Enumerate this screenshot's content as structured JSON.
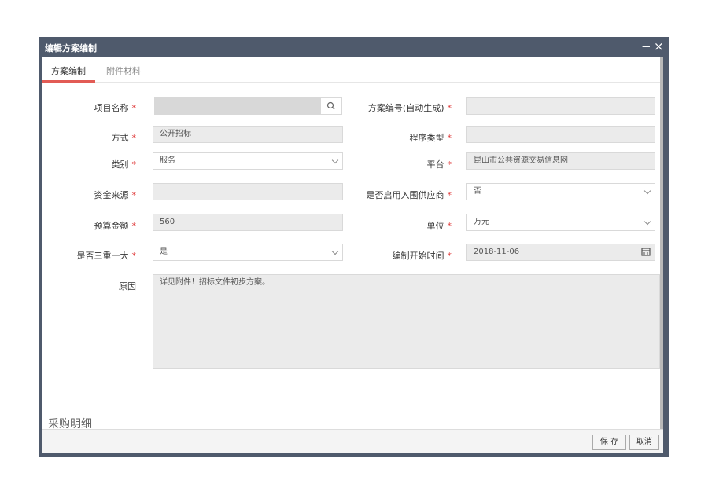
{
  "dialog": {
    "title": "编辑方案编制",
    "minimize": "−",
    "close": "×"
  },
  "tabs": [
    {
      "label": "方案编制"
    },
    {
      "label": "附件材料"
    }
  ],
  "form": {
    "required_mark": "*",
    "project_name": {
      "label": "项目名称",
      "value": ""
    },
    "plan_number": {
      "label": "方案编号(自动生成)",
      "value": ""
    },
    "method": {
      "label": "方式",
      "value": "公开招标"
    },
    "procedure_type": {
      "label": "程序类型",
      "value": ""
    },
    "category": {
      "label": "类别",
      "value": "服务"
    },
    "platform": {
      "label": "平台",
      "value": "昆山市公共资源交易信息网"
    },
    "fund_source": {
      "label": "资金来源",
      "value": ""
    },
    "enable_supplier": {
      "label": "是否启用入围供应商",
      "value": "否"
    },
    "budget": {
      "label": "预算金额",
      "value": "560"
    },
    "unit": {
      "label": "单位",
      "value": "万元"
    },
    "three_one": {
      "label": "是否三重一大",
      "value": "是"
    },
    "start_time": {
      "label": "编制开始时间",
      "value": "2018-11-06"
    },
    "reason": {
      "label": "原因",
      "value": "详见附件！招标文件初步方案。"
    }
  },
  "section": {
    "title": "采购明细"
  },
  "buttons": {
    "save": "保 存",
    "cancel": "取消"
  },
  "icons": {
    "search": "search-icon",
    "calendar": "calendar-icon",
    "chevron": "chevron-down-icon"
  }
}
